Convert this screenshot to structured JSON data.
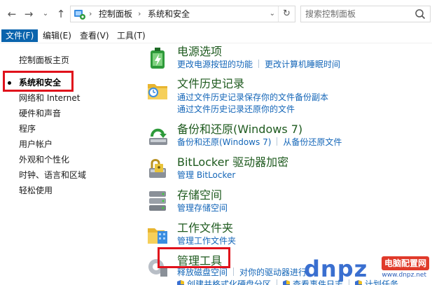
{
  "address": {
    "crumbs": [
      "控制面板",
      "系统和安全"
    ],
    "search_placeholder": "搜索控制面板"
  },
  "menu": {
    "file": "文件(F)",
    "edit": "编辑(E)",
    "view": "查看(V)",
    "tools": "工具(T)"
  },
  "leftnav": {
    "home": "控制面板主页",
    "items": [
      "系统和安全",
      "网络和 Internet",
      "硬件和声音",
      "程序",
      "用户帐户",
      "外观和个性化",
      "时钟、语言和区域",
      "轻松使用"
    ],
    "current": "系统和安全"
  },
  "sections": [
    {
      "title": "电源选项",
      "links": [
        "更改电源按钮的功能",
        "更改计算机睡眠时间"
      ],
      "icon": "power-options-icon"
    },
    {
      "title": "文件历史记录",
      "links": [
        "通过文件历史记录保存你的文件备份副本",
        "通过文件历史记录还原你的文件"
      ],
      "icon": "file-history-icon"
    },
    {
      "title": "备份和还原(Windows 7)",
      "links": [
        "备份和还原(Windows 7)",
        "从备份还原文件"
      ],
      "icon": "backup-restore-icon"
    },
    {
      "title": "BitLocker 驱动器加密",
      "links": [
        "管理 BitLocker"
      ],
      "icon": "bitlocker-icon"
    },
    {
      "title": "存储空间",
      "links": [
        "管理存储空间"
      ],
      "icon": "storage-spaces-icon"
    },
    {
      "title": "工作文件夹",
      "links": [
        "管理工作文件夹"
      ],
      "icon": "work-folders-icon"
    },
    {
      "title": "管理工具",
      "links": [
        "释放磁盘空间",
        "对你的驱动器进行",
        "创建并格式化硬盘分区",
        "查看事件日志",
        "计划任务"
      ],
      "icon": "admin-tools-icon"
    }
  ],
  "watermark": {
    "big": "dnpz",
    "tag": "电脑配置网",
    "url": "www.dnpz.net"
  },
  "colors": {
    "accent": "#0a64ad",
    "link": "#1466b8",
    "title": "#1e5a1e",
    "highlight": "#e0111b"
  }
}
